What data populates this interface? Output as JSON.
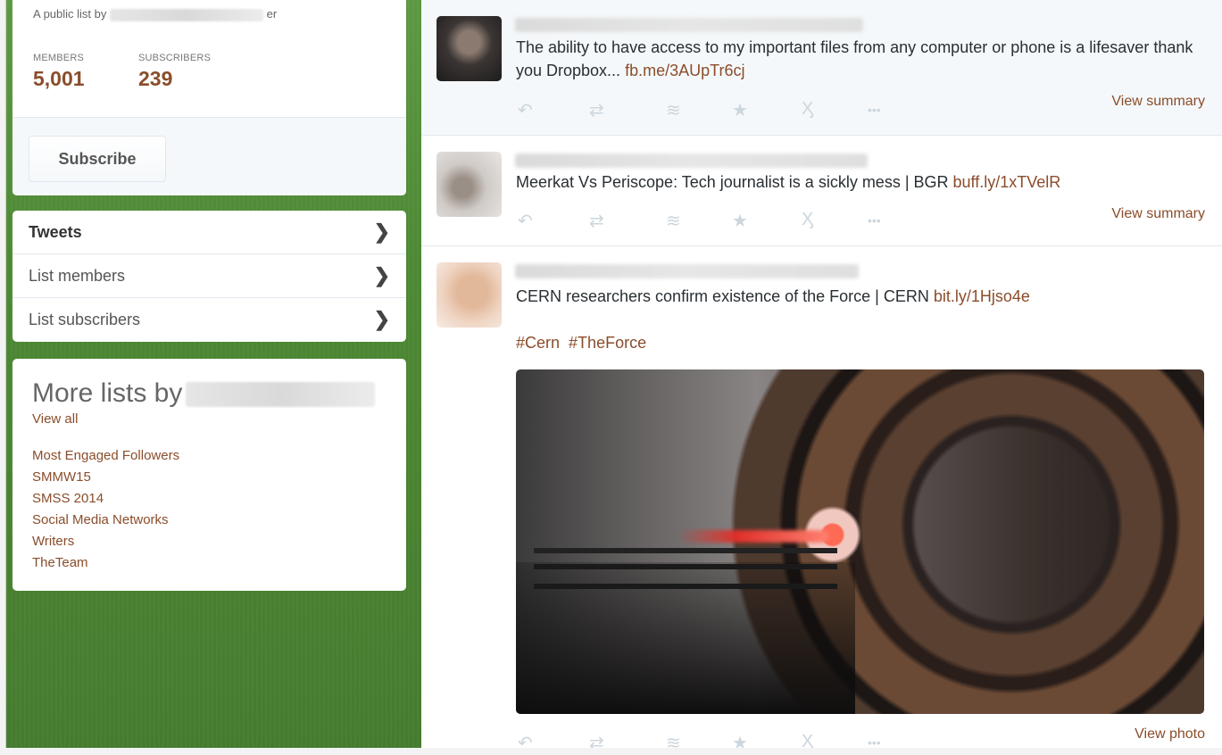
{
  "list_card": {
    "byline_prefix": "A public list by",
    "byline_suffix": "er",
    "members_label": "MEMBERS",
    "members_value": "5,001",
    "subscribers_label": "SUBSCRIBERS",
    "subscribers_value": "239",
    "subscribe_button": "Subscribe"
  },
  "nav": {
    "items": [
      {
        "label": "Tweets"
      },
      {
        "label": "List members"
      },
      {
        "label": "List subscribers"
      }
    ],
    "chevron": "❯"
  },
  "more_lists": {
    "title": "More lists by",
    "view_all": "View all",
    "lists": [
      "Most Engaged Followers",
      "SMMW15",
      "SMSS 2014",
      "Social Media Networks",
      "Writers",
      "TheTeam"
    ]
  },
  "tweet_actions": {
    "reply_icon": "↶",
    "retweet_icon": "⇄",
    "buffer_icon": "≋",
    "favorite_icon": "★",
    "hootsuite_icon": "Ӽ",
    "more_icon": "•••"
  },
  "tweets": [
    {
      "text": "The ability to have access to my important files from any computer or phone is a lifesaver thank you Dropbox...",
      "link": "fb.me/3AUpTr6cj",
      "summary_link": "View summary"
    },
    {
      "text": "Meerkat Vs Periscope: Tech journalist is a sickly mess | BGR",
      "link": "buff.ly/1xTVelR",
      "summary_link": "View summary"
    },
    {
      "text": "CERN researchers confirm existence of the Force | CERN",
      "link": "bit.ly/1Hjso4e",
      "hashtag1": "#Cern",
      "hashtag2": "#TheForce",
      "summary_link": "View photo"
    }
  ],
  "colors": {
    "link": "#8a4d2b",
    "background_green": "#4f8b36",
    "highlight_row": "#f5f8fa"
  }
}
